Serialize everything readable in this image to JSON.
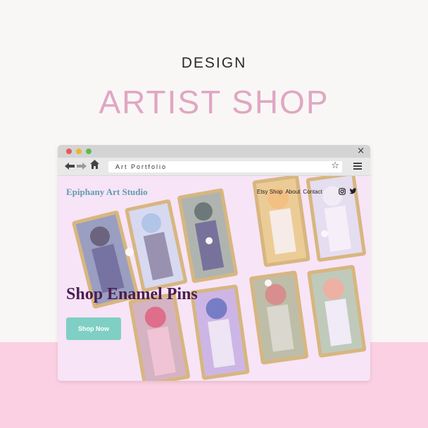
{
  "header": {
    "kicker": "DESIGN",
    "title": "ARTIST SHOP"
  },
  "browser": {
    "window_controls": [
      "red",
      "yellow",
      "green"
    ],
    "close_icon": "×",
    "nav": {
      "back": "🡐",
      "forward": "🡒",
      "home": "🏠"
    },
    "address": "Art Portfolio",
    "bookmark_icon": "☆"
  },
  "site": {
    "brand": "Epiphany Art Studio",
    "nav": [
      "Etsy Shop",
      "About",
      "Contact"
    ],
    "social": [
      "instagram-icon",
      "twitter-icon"
    ],
    "hero_title": "Shop Enamel Pins",
    "cta_label": "Shop Now"
  },
  "colors": {
    "page_bg": "#f9f7f5",
    "accent_pink": "#e1a6c4",
    "band_pink": "#fbd0e2",
    "brand_teal": "#5f9cb3",
    "hero_purple": "#4a1d52",
    "button_teal": "#7fcfc4"
  }
}
